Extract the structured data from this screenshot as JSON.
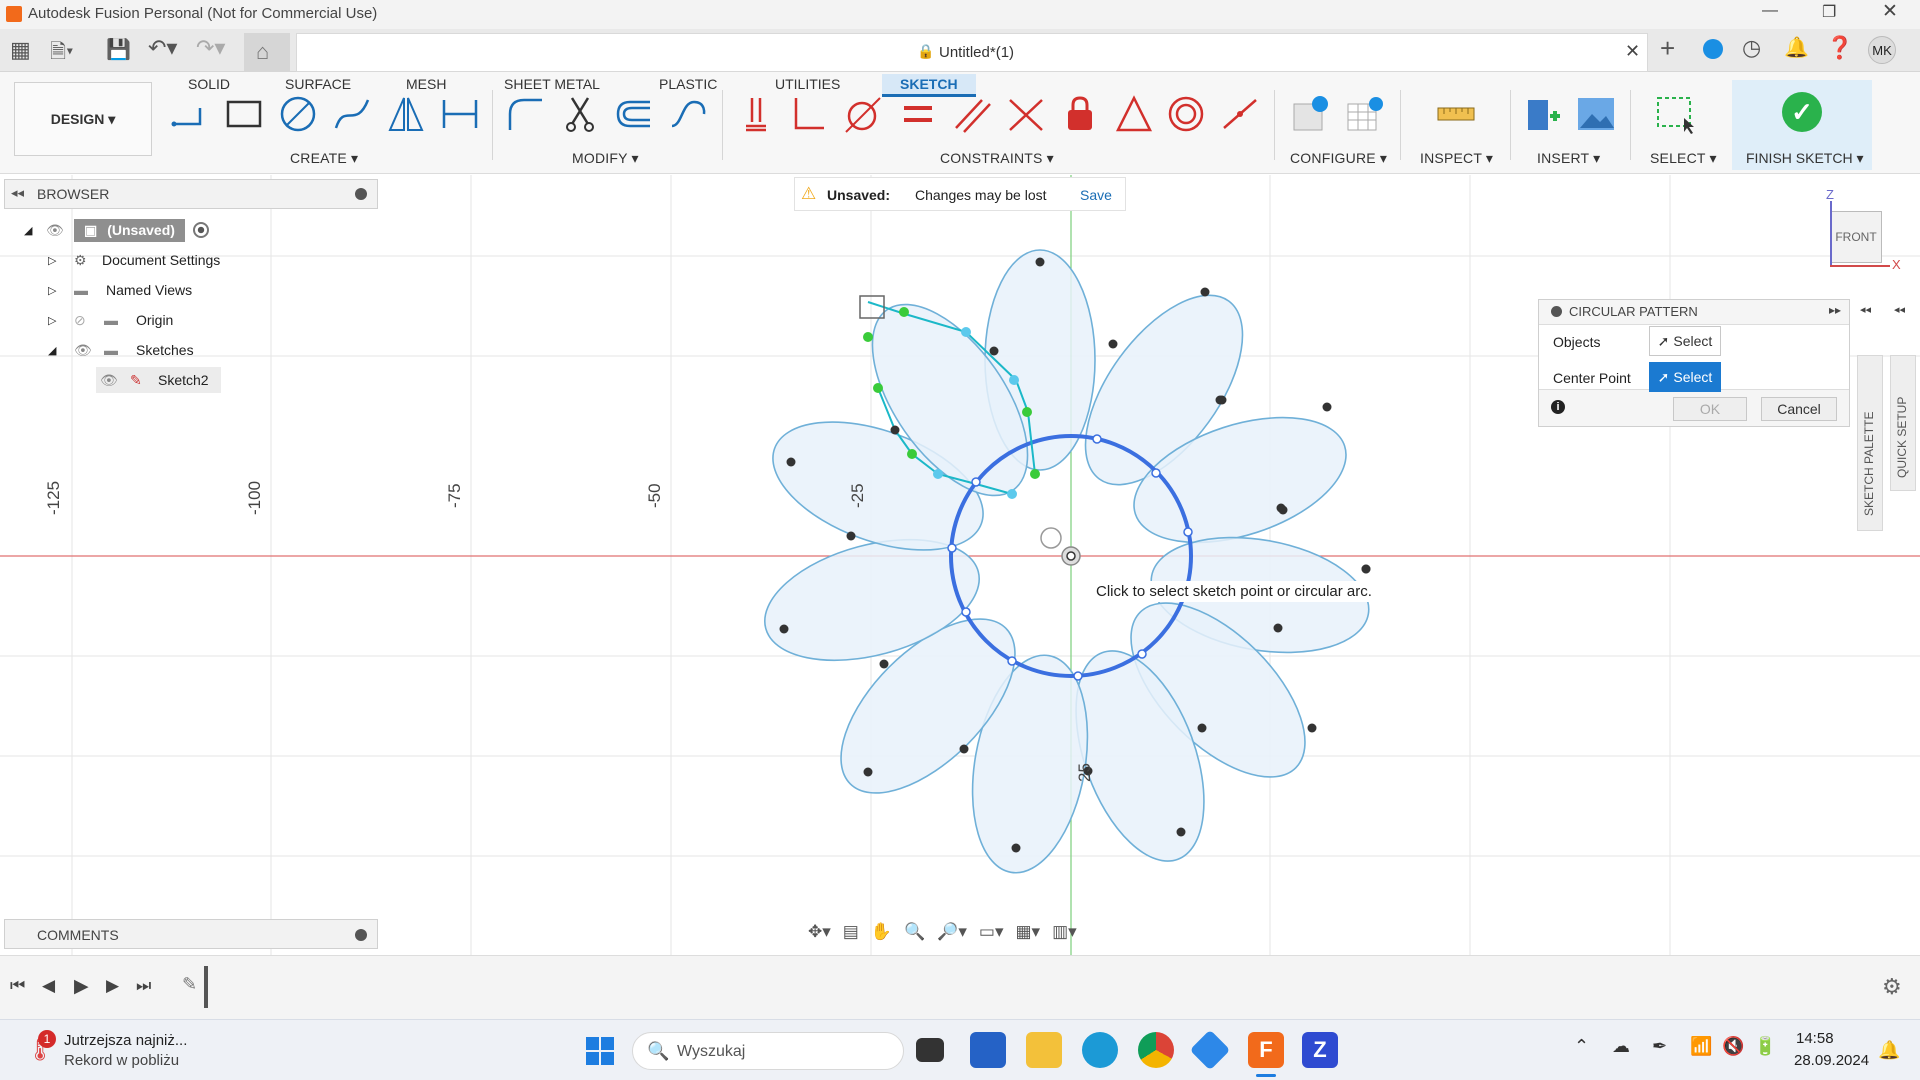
{
  "window": {
    "title": "Autodesk Fusion Personal (Not for Commercial Use)"
  },
  "document": {
    "title": "Untitled*(1)",
    "user_initials": "MK"
  },
  "workspace": {
    "label": "DESIGN ▾"
  },
  "ribbon_tabs": [
    "SOLID",
    "SURFACE",
    "MESH",
    "SHEET METAL",
    "PLASTIC",
    "UTILITIES",
    "SKETCH"
  ],
  "ribbon_groups": {
    "create": "CREATE ▾",
    "modify": "MODIFY ▾",
    "constraints": "CONSTRAINTS ▾",
    "configure": "CONFIGURE ▾",
    "inspect": "INSPECT ▾",
    "insert": "INSERT ▾",
    "select": "SELECT ▾",
    "finish": "FINISH SKETCH ▾"
  },
  "unsaved_banner": {
    "label": "Unsaved:",
    "message": "Changes may be lost",
    "action": "Save"
  },
  "browser": {
    "title": "BROWSER",
    "root": "(Unsaved)",
    "items": [
      "Document Settings",
      "Named Views",
      "Origin",
      "Sketches"
    ],
    "sketch": "Sketch2"
  },
  "comments": {
    "title": "COMMENTS"
  },
  "ruler_labels": [
    "-125",
    "-100",
    "-75",
    "-50",
    "-25",
    "25"
  ],
  "tooltip": "Click to select sketch point or circular arc.",
  "viewcube": {
    "face": "FRONT",
    "axis_z": "Z",
    "axis_x": "X"
  },
  "circular_pattern": {
    "title": "CIRCULAR PATTERN",
    "objects_label": "Objects",
    "objects_button": "Select",
    "center_label": "Center Point",
    "center_button": "Select",
    "ok": "OK",
    "cancel": "Cancel"
  },
  "side_tabs": {
    "sketch_palette": "SKETCH PALETTE",
    "quick_setup": "QUICK SETUP"
  },
  "taskbar": {
    "weather_title": "Jutrzejsza najniż...",
    "weather_sub": "Rekord w pobliżu",
    "weather_badge": "1",
    "search_placeholder": "Wyszukaj",
    "time": "14:58",
    "date": "28.09.2024"
  },
  "colors": {
    "accent": "#1a6db5",
    "sketch_blue": "#3b6fe0",
    "finish_green": "#2ab24c",
    "petal_fill": "#e8f1fa"
  }
}
